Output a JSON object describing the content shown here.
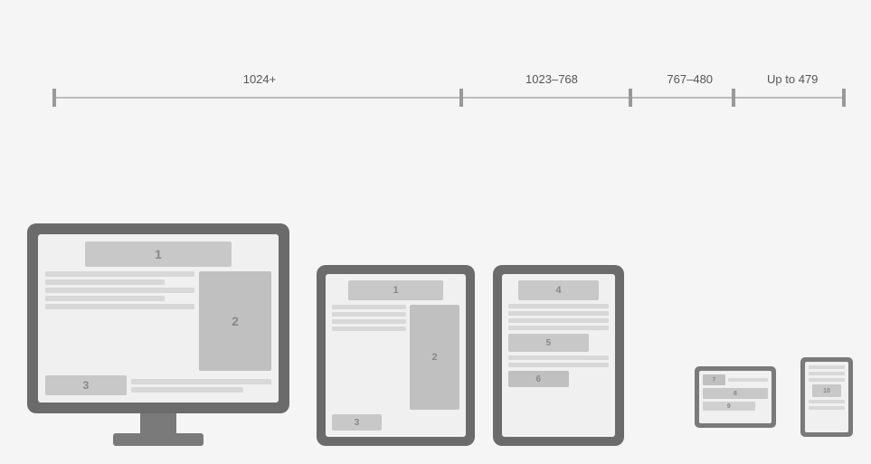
{
  "timeline": {
    "segments": [
      {
        "id": "seg1",
        "label": "1024+"
      },
      {
        "id": "seg2",
        "label": "1023–768"
      },
      {
        "id": "seg3",
        "label": "767–480"
      },
      {
        "id": "seg4",
        "label": "Up to 479"
      }
    ]
  },
  "devices": {
    "monitor": {
      "label": "Desktop Monitor",
      "blocks": {
        "b1": "1",
        "b2": "2",
        "b3": "3"
      }
    },
    "tablet_landscape": {
      "label": "Tablet Landscape",
      "blocks": {
        "b1": "1",
        "b2": "2",
        "b3": "3"
      }
    },
    "tablet_portrait": {
      "label": "Tablet Portrait",
      "blocks": {
        "b4": "4",
        "b5": "5",
        "b6": "6"
      }
    },
    "phone_landscape": {
      "label": "Phone Landscape",
      "blocks": {
        "b7": "7",
        "b8": "8",
        "b9": "9"
      }
    },
    "phone_portrait": {
      "label": "Phone Portrait",
      "blocks": {
        "b10": "10"
      }
    }
  }
}
